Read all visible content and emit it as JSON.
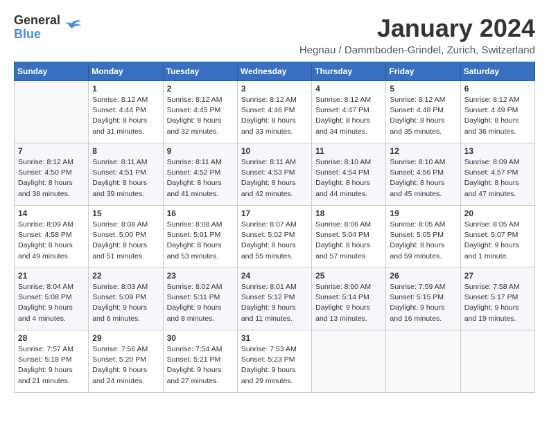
{
  "header": {
    "logo_line1": "General",
    "logo_line2": "Blue",
    "title": "January 2024",
    "location": "Hegnau / Dammboden-Grindel, Zurich, Switzerland"
  },
  "weekdays": [
    "Sunday",
    "Monday",
    "Tuesday",
    "Wednesday",
    "Thursday",
    "Friday",
    "Saturday"
  ],
  "weeks": [
    [
      {
        "day": "",
        "sunrise": "",
        "sunset": "",
        "daylight": ""
      },
      {
        "day": "1",
        "sunrise": "Sunrise: 8:12 AM",
        "sunset": "Sunset: 4:44 PM",
        "daylight": "Daylight: 8 hours and 31 minutes."
      },
      {
        "day": "2",
        "sunrise": "Sunrise: 8:12 AM",
        "sunset": "Sunset: 4:45 PM",
        "daylight": "Daylight: 8 hours and 32 minutes."
      },
      {
        "day": "3",
        "sunrise": "Sunrise: 8:12 AM",
        "sunset": "Sunset: 4:46 PM",
        "daylight": "Daylight: 8 hours and 33 minutes."
      },
      {
        "day": "4",
        "sunrise": "Sunrise: 8:12 AM",
        "sunset": "Sunset: 4:47 PM",
        "daylight": "Daylight: 8 hours and 34 minutes."
      },
      {
        "day": "5",
        "sunrise": "Sunrise: 8:12 AM",
        "sunset": "Sunset: 4:48 PM",
        "daylight": "Daylight: 8 hours and 35 minutes."
      },
      {
        "day": "6",
        "sunrise": "Sunrise: 8:12 AM",
        "sunset": "Sunset: 4:49 PM",
        "daylight": "Daylight: 8 hours and 36 minutes."
      }
    ],
    [
      {
        "day": "7",
        "sunrise": "Sunrise: 8:12 AM",
        "sunset": "Sunset: 4:50 PM",
        "daylight": "Daylight: 8 hours and 38 minutes."
      },
      {
        "day": "8",
        "sunrise": "Sunrise: 8:11 AM",
        "sunset": "Sunset: 4:51 PM",
        "daylight": "Daylight: 8 hours and 39 minutes."
      },
      {
        "day": "9",
        "sunrise": "Sunrise: 8:11 AM",
        "sunset": "Sunset: 4:52 PM",
        "daylight": "Daylight: 8 hours and 41 minutes."
      },
      {
        "day": "10",
        "sunrise": "Sunrise: 8:11 AM",
        "sunset": "Sunset: 4:53 PM",
        "daylight": "Daylight: 8 hours and 42 minutes."
      },
      {
        "day": "11",
        "sunrise": "Sunrise: 8:10 AM",
        "sunset": "Sunset: 4:54 PM",
        "daylight": "Daylight: 8 hours and 44 minutes."
      },
      {
        "day": "12",
        "sunrise": "Sunrise: 8:10 AM",
        "sunset": "Sunset: 4:56 PM",
        "daylight": "Daylight: 8 hours and 45 minutes."
      },
      {
        "day": "13",
        "sunrise": "Sunrise: 8:09 AM",
        "sunset": "Sunset: 4:57 PM",
        "daylight": "Daylight: 8 hours and 47 minutes."
      }
    ],
    [
      {
        "day": "14",
        "sunrise": "Sunrise: 8:09 AM",
        "sunset": "Sunset: 4:58 PM",
        "daylight": "Daylight: 8 hours and 49 minutes."
      },
      {
        "day": "15",
        "sunrise": "Sunrise: 8:08 AM",
        "sunset": "Sunset: 5:00 PM",
        "daylight": "Daylight: 8 hours and 51 minutes."
      },
      {
        "day": "16",
        "sunrise": "Sunrise: 8:08 AM",
        "sunset": "Sunset: 5:01 PM",
        "daylight": "Daylight: 8 hours and 53 minutes."
      },
      {
        "day": "17",
        "sunrise": "Sunrise: 8:07 AM",
        "sunset": "Sunset: 5:02 PM",
        "daylight": "Daylight: 8 hours and 55 minutes."
      },
      {
        "day": "18",
        "sunrise": "Sunrise: 8:06 AM",
        "sunset": "Sunset: 5:04 PM",
        "daylight": "Daylight: 8 hours and 57 minutes."
      },
      {
        "day": "19",
        "sunrise": "Sunrise: 8:05 AM",
        "sunset": "Sunset: 5:05 PM",
        "daylight": "Daylight: 8 hours and 59 minutes."
      },
      {
        "day": "20",
        "sunrise": "Sunrise: 8:05 AM",
        "sunset": "Sunset: 5:07 PM",
        "daylight": "Daylight: 9 hours and 1 minute."
      }
    ],
    [
      {
        "day": "21",
        "sunrise": "Sunrise: 8:04 AM",
        "sunset": "Sunset: 5:08 PM",
        "daylight": "Daylight: 9 hours and 4 minutes."
      },
      {
        "day": "22",
        "sunrise": "Sunrise: 8:03 AM",
        "sunset": "Sunset: 5:09 PM",
        "daylight": "Daylight: 9 hours and 6 minutes."
      },
      {
        "day": "23",
        "sunrise": "Sunrise: 8:02 AM",
        "sunset": "Sunset: 5:11 PM",
        "daylight": "Daylight: 9 hours and 8 minutes."
      },
      {
        "day": "24",
        "sunrise": "Sunrise: 8:01 AM",
        "sunset": "Sunset: 5:12 PM",
        "daylight": "Daylight: 9 hours and 11 minutes."
      },
      {
        "day": "25",
        "sunrise": "Sunrise: 8:00 AM",
        "sunset": "Sunset: 5:14 PM",
        "daylight": "Daylight: 9 hours and 13 minutes."
      },
      {
        "day": "26",
        "sunrise": "Sunrise: 7:59 AM",
        "sunset": "Sunset: 5:15 PM",
        "daylight": "Daylight: 9 hours and 16 minutes."
      },
      {
        "day": "27",
        "sunrise": "Sunrise: 7:58 AM",
        "sunset": "Sunset: 5:17 PM",
        "daylight": "Daylight: 9 hours and 19 minutes."
      }
    ],
    [
      {
        "day": "28",
        "sunrise": "Sunrise: 7:57 AM",
        "sunset": "Sunset: 5:18 PM",
        "daylight": "Daylight: 9 hours and 21 minutes."
      },
      {
        "day": "29",
        "sunrise": "Sunrise: 7:56 AM",
        "sunset": "Sunset: 5:20 PM",
        "daylight": "Daylight: 9 hours and 24 minutes."
      },
      {
        "day": "30",
        "sunrise": "Sunrise: 7:54 AM",
        "sunset": "Sunset: 5:21 PM",
        "daylight": "Daylight: 9 hours and 27 minutes."
      },
      {
        "day": "31",
        "sunrise": "Sunrise: 7:53 AM",
        "sunset": "Sunset: 5:23 PM",
        "daylight": "Daylight: 9 hours and 29 minutes."
      },
      {
        "day": "",
        "sunrise": "",
        "sunset": "",
        "daylight": ""
      },
      {
        "day": "",
        "sunrise": "",
        "sunset": "",
        "daylight": ""
      },
      {
        "day": "",
        "sunrise": "",
        "sunset": "",
        "daylight": ""
      }
    ]
  ]
}
